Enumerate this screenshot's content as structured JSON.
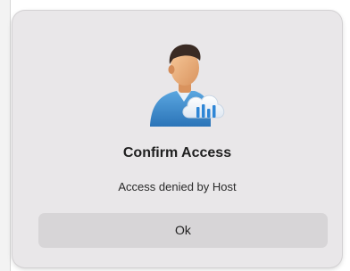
{
  "dialog": {
    "title": "Confirm Access",
    "message": "Access denied by Host",
    "ok_label": "Ok",
    "icon": "user-cloud-icon"
  },
  "colors": {
    "dialog_bg": "#e9e7e9",
    "button_bg": "#d7d5d7",
    "text": "#1f1f1f",
    "shirt": "#3d8fcf",
    "cloud_bars": "#2e86d6"
  }
}
